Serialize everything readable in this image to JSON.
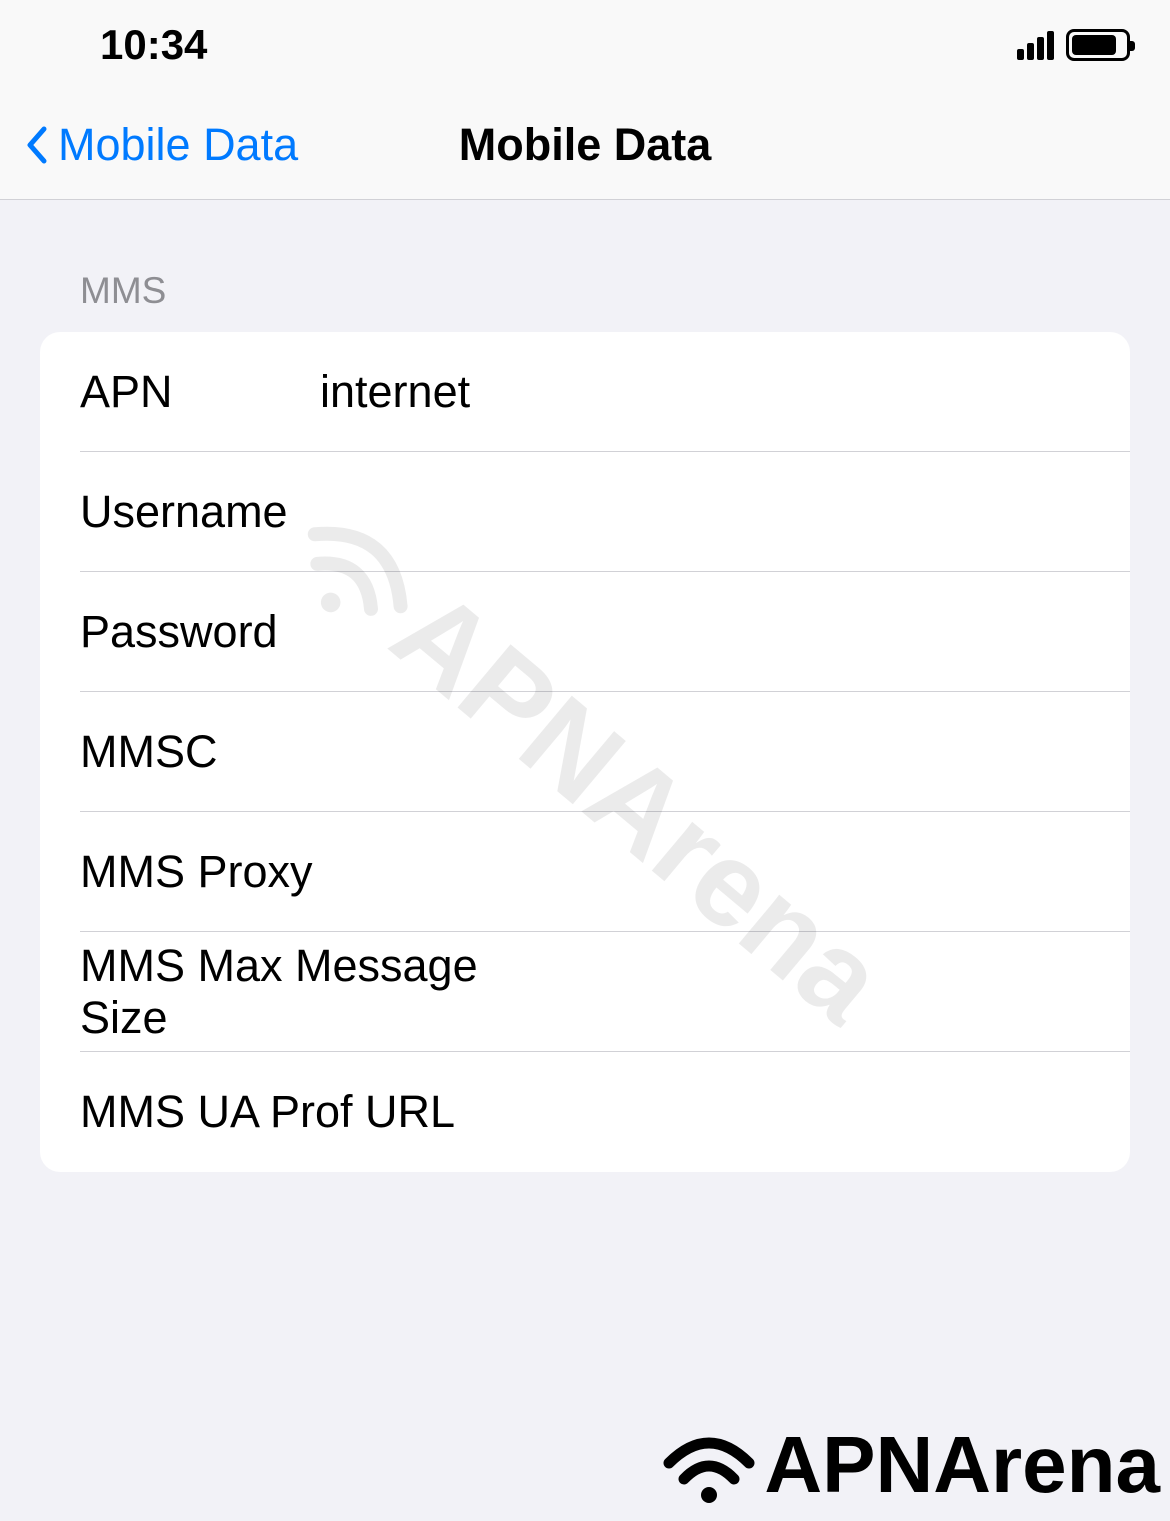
{
  "status_bar": {
    "time": "10:34"
  },
  "nav": {
    "back_label": "Mobile Data",
    "title": "Mobile Data"
  },
  "section_header": "MMS",
  "fields": {
    "apn": {
      "label": "APN",
      "value": "internet"
    },
    "username": {
      "label": "Username",
      "value": ""
    },
    "password": {
      "label": "Password",
      "value": ""
    },
    "mmsc": {
      "label": "MMSC",
      "value": ""
    },
    "mms_proxy": {
      "label": "MMS Proxy",
      "value": ""
    },
    "mms_max_size": {
      "label": "MMS Max Message Size",
      "value": ""
    },
    "mms_ua_prof": {
      "label": "MMS UA Prof URL",
      "value": ""
    }
  },
  "watermark": "APNArena",
  "footer_brand": "APNArena"
}
